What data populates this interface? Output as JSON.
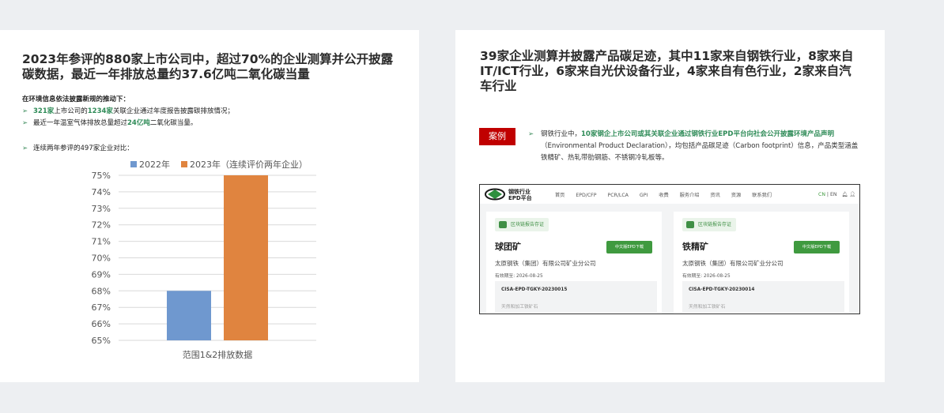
{
  "left": {
    "title": "2023年参评的880家上市公司中，超过70%的企业测算并公开披露碳数据，最近一年排放总量约37.6亿吨二氧化碳当量",
    "context_heading": "在环境信息依法披露新规的推动下：",
    "bullets": [
      {
        "hl": "321家",
        "mid": "上市公司的",
        "hl2": "1234家",
        "rest": "关联企业通过年度报告披露碳排放情况；"
      },
      {
        "pre": "最近一年温室气体排放总量超过",
        "hl": "24亿吨",
        "rest": "二氧化碳当量。"
      }
    ],
    "bullet3": "连续两年参评的497家企业对比："
  },
  "chart_data": {
    "type": "bar",
    "categories": [
      "范围1&2排放数据"
    ],
    "series": [
      {
        "name": "2022年",
        "values": [
          68
        ],
        "color": "#6f98cf"
      },
      {
        "name": "2023年（连续评价两年企业）",
        "values": [
          75
        ],
        "color": "#e0843f"
      }
    ],
    "ylim": [
      65,
      75
    ],
    "yticks": [
      "65%",
      "66%",
      "67%",
      "68%",
      "69%",
      "70%",
      "71%",
      "72%",
      "73%",
      "74%",
      "75%"
    ],
    "legend": "top",
    "grid": true
  },
  "right": {
    "title": "39家企业测算并披露产品碳足迹，其中11家来自钢铁行业，8家来自IT/ICT行业，6家来自光伏设备行业，4家来自有色行业，2家来自汽车行业",
    "badge": "案例",
    "case_pre": "钢铁行业中，",
    "case_hl": "10家钢企上市公司或其关联企业通过钢铁行业EPD平台向社会公开披露环境产品声明",
    "case_rest": "（Environmental Product Declaration），均包括产品碳足迹（Carbon footprint）信息，产品类型涵盖铁精矿、热轧带肋钢筋、不锈钢冷轧板等。"
  },
  "website": {
    "logo_line1": "钢铁行业",
    "logo_line2": "EPD平台",
    "nav": [
      "首页",
      "EPD/CFP",
      "PCR/LCA",
      "GPI",
      "收费",
      "服务介绍",
      "资讯",
      "资源",
      "联系我们"
    ],
    "lang_cn": "CN",
    "lang_sep": "|",
    "lang_en": "EN",
    "cards": [
      {
        "chip": "区块链报告存证",
        "title": "球团矿",
        "button": "中文版EPD下载",
        "company": "太原钢铁（集团）有限公司矿业分公司",
        "valid": "有效期至: 2026-08-25",
        "code": "CISA-EPD-TGKY-20230015",
        "desc": "天然和加工铁矿石"
      },
      {
        "chip": "区块链报告存证",
        "title": "铁精矿",
        "button": "中文版EPD下载",
        "company": "太原钢铁（集团）有限公司矿业分公司",
        "valid": "有效期至: 2026-08-25",
        "code": "CISA-EPD-TGKY-20230014",
        "desc": "天然和加工铁矿石"
      }
    ]
  }
}
